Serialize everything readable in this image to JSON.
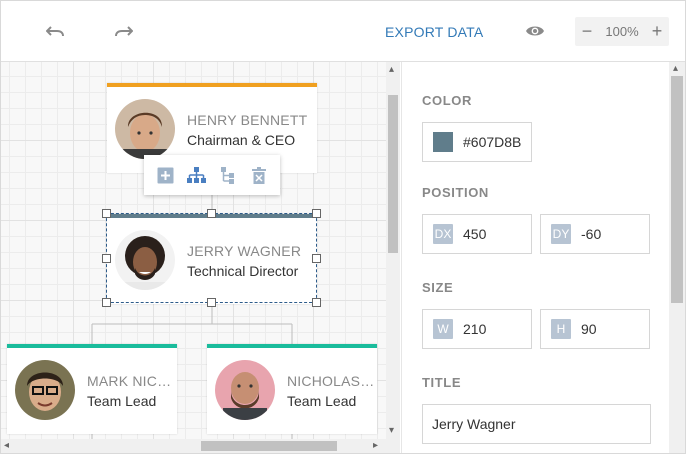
{
  "toolbar": {
    "undo_icon": "undo-icon",
    "redo_icon": "redo-icon",
    "export_label": "EXPORT DATA",
    "preview_icon": "eye-icon",
    "zoom": {
      "minus": "−",
      "value": "100%",
      "plus": "+"
    }
  },
  "canvas": {
    "cards": [
      {
        "name": "HENRY BENNETT",
        "role": "Chairman & CEO",
        "accent": "#F0A020"
      },
      {
        "name": "JERRY WAGNER",
        "role": "Technical Director",
        "accent": "#607D8B"
      },
      {
        "name": "MARK NICH…",
        "role": "Team Lead",
        "accent": "#1ABC9C"
      },
      {
        "name": "NICHOLAS …",
        "role": "Team Lead",
        "accent": "#1ABC9C"
      }
    ],
    "context_menu": [
      "add-icon",
      "org-chart-icon",
      "tree-icon",
      "delete-icon"
    ]
  },
  "panel": {
    "color": {
      "label": "COLOR",
      "value": "#607D8B"
    },
    "position": {
      "label": "POSITION",
      "dx_tag": "DX",
      "dx": "450",
      "dy_tag": "DY",
      "dy": "-60"
    },
    "size": {
      "label": "SIZE",
      "w_tag": "W",
      "w": "210",
      "h_tag": "H",
      "h": "90"
    },
    "title": {
      "label": "TITLE",
      "value": "Jerry Wagner"
    }
  }
}
